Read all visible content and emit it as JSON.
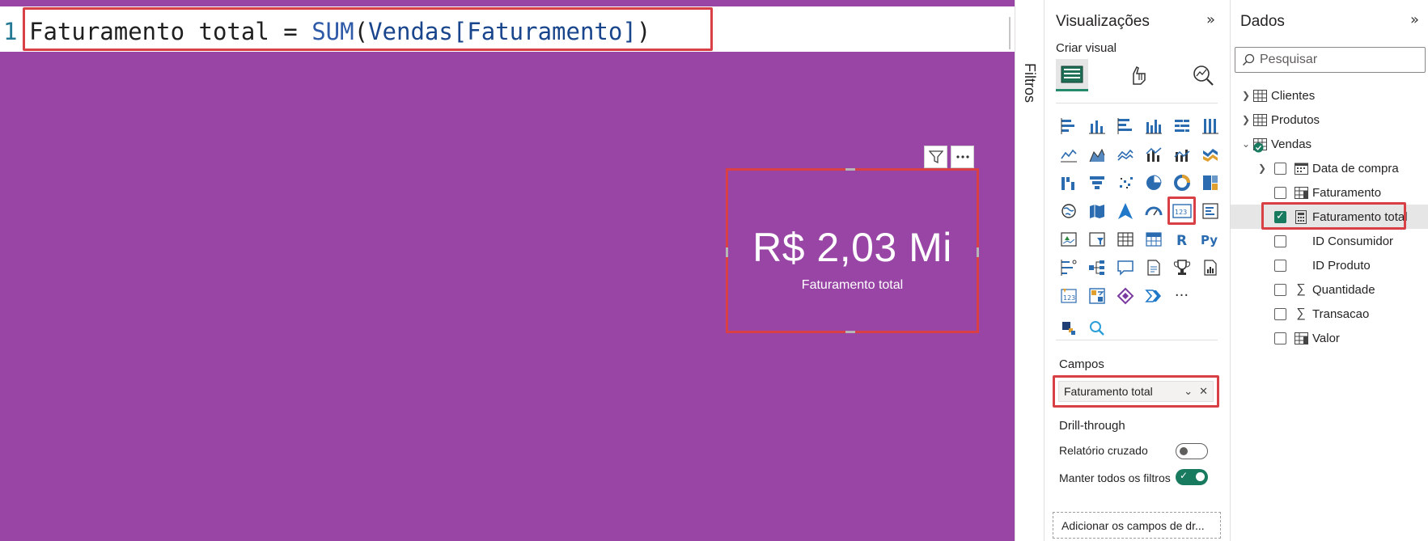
{
  "formula": {
    "line_number": "1",
    "measure": "Faturamento total",
    "operator": " = ",
    "function": "SUM",
    "open_paren": "(",
    "table": "Vendas",
    "column": "[Faturamento]",
    "close_paren": ")"
  },
  "card": {
    "value": "R$ 2,03 Mi",
    "label": "Faturamento total"
  },
  "filters": {
    "label": "Filtros"
  },
  "visualizations": {
    "title": "Visualizações",
    "subtitle": "Criar visual",
    "campos_label": "Campos",
    "campos_field": "Faturamento total",
    "drill_label": "Drill-through",
    "cross_report_label": "Relatório cruzado",
    "cross_report_on": false,
    "keep_filters_label": "Manter todos os filtros",
    "keep_filters_on": true,
    "drill_drop_label": "Adicionar os campos de dr...",
    "more_label": "···"
  },
  "data": {
    "title": "Dados",
    "search_placeholder": "Pesquisar",
    "tables": [
      {
        "name": "Clientes",
        "expanded": false
      },
      {
        "name": "Produtos",
        "expanded": false
      },
      {
        "name": "Vendas",
        "expanded": true
      }
    ],
    "fields": [
      {
        "name": "Data de compra",
        "icon": "calendar-icon",
        "checked": false,
        "expandable": true
      },
      {
        "name": "Faturamento",
        "icon": "column-icon",
        "checked": false
      },
      {
        "name": "Faturamento total",
        "icon": "calculator-icon",
        "checked": true
      },
      {
        "name": "ID Consumidor",
        "icon": "none",
        "checked": false
      },
      {
        "name": "ID Produto",
        "icon": "none",
        "checked": false
      },
      {
        "name": "Quantidade",
        "icon": "sigma-icon",
        "checked": false
      },
      {
        "name": "Transacao",
        "icon": "sigma-icon",
        "checked": false
      },
      {
        "name": "Valor",
        "icon": "column-icon",
        "checked": false
      }
    ]
  },
  "colors": {
    "canvas": "#9845a6",
    "accent": "#187a5f",
    "highlight": "#d84045"
  }
}
